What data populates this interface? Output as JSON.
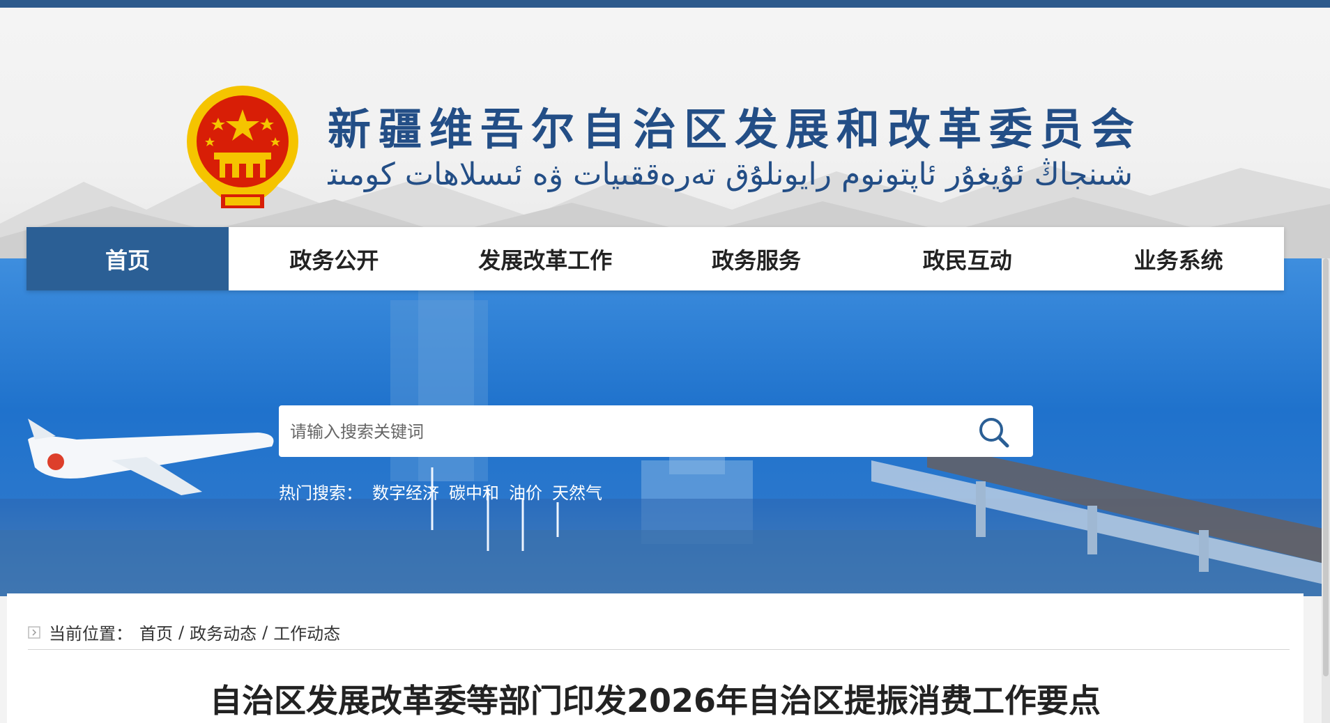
{
  "site": {
    "title": "新疆维吾尔自治区发展和改革委员会",
    "subtitle": "شىنجاڭ ئۇيغۇر ئاپتونوم رايونلۇق تەرەققىيات ۋە ئىسلاھات كومىتېتى"
  },
  "nav": {
    "items": [
      {
        "label": "首页",
        "active": true
      },
      {
        "label": "政务公开"
      },
      {
        "label": "发展改革工作"
      },
      {
        "label": "政务服务"
      },
      {
        "label": "政民互动"
      },
      {
        "label": "业务系统"
      }
    ]
  },
  "search": {
    "placeholder": "请输入搜索关键词",
    "hot_label": "热门搜索：",
    "hot_terms": [
      "数字经济",
      "碳中和",
      "油价",
      "天然气"
    ]
  },
  "breadcrumb": {
    "label": "当前位置：",
    "items": [
      "首页",
      "政务动态",
      "工作动态"
    ],
    "separator": "/"
  },
  "article": {
    "title": "自治区发展改革委等部门印发2026年自治区提振消费工作要点"
  },
  "colors": {
    "brand": "#234e86",
    "nav_active": "#2b5f95",
    "top_strip": "#2d5a8c",
    "emblem_red": "#d81e06",
    "emblem_gold": "#f5c400"
  },
  "icons": {
    "emblem": "national-emblem",
    "search": "search-icon",
    "breadcrumb": "breadcrumb-arrow-icon"
  }
}
